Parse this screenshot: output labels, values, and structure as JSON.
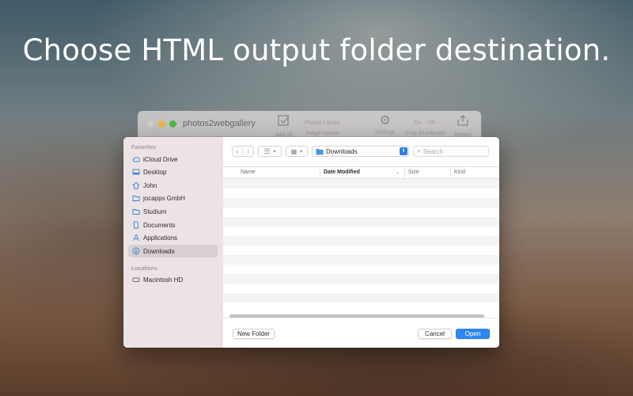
{
  "headline": "Choose HTML output folder destination.",
  "app": {
    "title": "photos2webgallery",
    "toolbar": {
      "add_all": "Add all",
      "image_source_value": "Photos Library",
      "image_source_label": "Image source",
      "settings": "Settings",
      "crop_on": "On",
      "crop_off": "Off",
      "crop_label": "Crop thumbnails",
      "extract": "Extract"
    }
  },
  "dialog": {
    "sidebar": {
      "favorites_title": "Favorites",
      "favorites": [
        {
          "label": "iCloud Drive",
          "icon": "cloud-icon"
        },
        {
          "label": "Desktop",
          "icon": "desktop-icon"
        },
        {
          "label": "John",
          "icon": "home-icon"
        },
        {
          "label": "jocapps GmbH",
          "icon": "folder-icon"
        },
        {
          "label": "Studium",
          "icon": "folder-icon"
        },
        {
          "label": "Documents",
          "icon": "document-icon"
        },
        {
          "label": "Applications",
          "icon": "applications-icon"
        },
        {
          "label": "Downloads",
          "icon": "download-icon",
          "selected": true
        }
      ],
      "locations_title": "Locations",
      "locations": [
        {
          "label": "Macintosh HD",
          "icon": "disk-icon"
        }
      ]
    },
    "toolbar": {
      "back": "‹",
      "forward": "›",
      "current_folder": "Downloads",
      "search_placeholder": "Search"
    },
    "columns": {
      "name": "Name",
      "date_modified": "Date Modified",
      "size": "Size",
      "kind": "Kind"
    },
    "buttons": {
      "new_folder": "New Folder",
      "cancel": "Cancel",
      "open": "Open"
    },
    "colors": {
      "accent": "#2f86f0",
      "sidebar_bg": "#ece3e4"
    }
  }
}
